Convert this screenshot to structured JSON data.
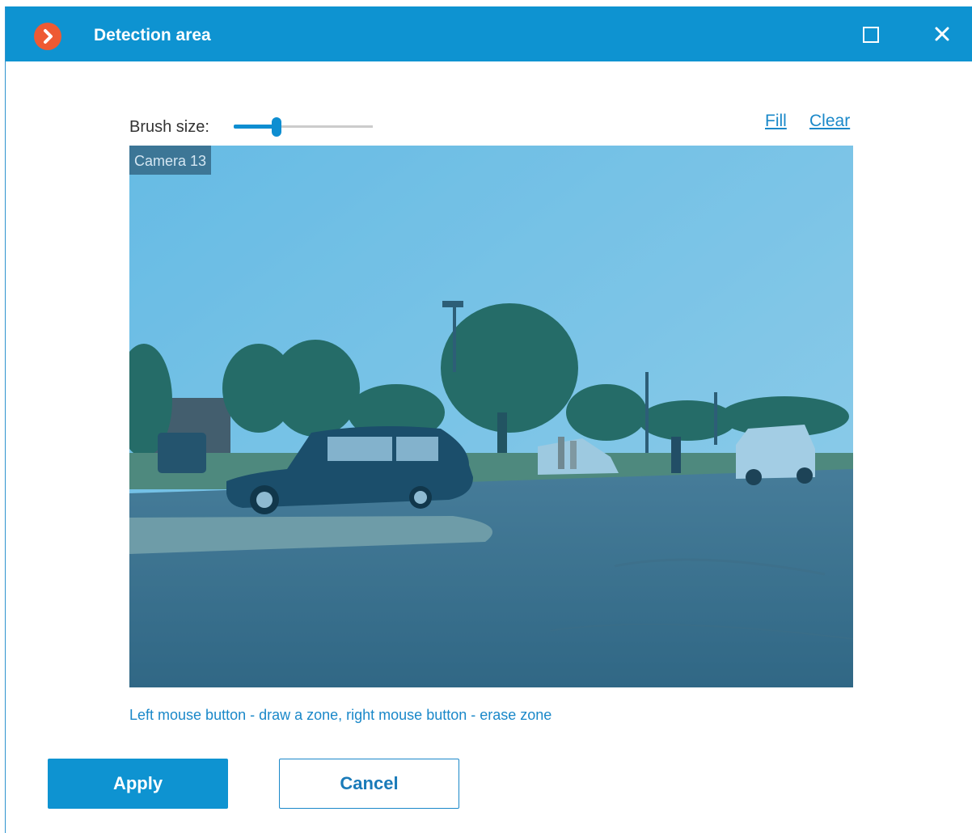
{
  "window": {
    "title": "Detection area",
    "accent_color": "#0e93d1",
    "logo_color": "#ee5a33",
    "maximize_icon": "maximize-icon",
    "close_icon": "close-icon"
  },
  "toolbar": {
    "brush_label": "Brush size:",
    "brush_size_fraction": 0.31,
    "fill_label": "Fill",
    "clear_label": "Clear"
  },
  "video": {
    "camera_name": "Camera 13",
    "overlay_color": "#1b8fcf"
  },
  "hint": "Left mouse button - draw a zone, right mouse button - erase zone",
  "buttons": {
    "apply_label": "Apply",
    "cancel_label": "Cancel"
  }
}
